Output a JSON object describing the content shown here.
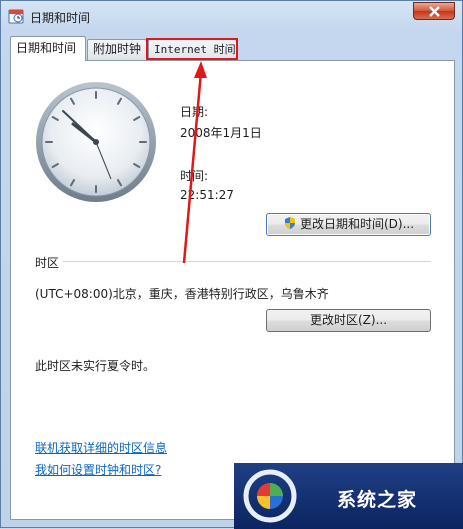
{
  "window": {
    "title": "日期和时间",
    "app_icon": "calendar-clock-icon",
    "close_icon": "close-icon"
  },
  "tabs": [
    {
      "label": "日期和时间",
      "selected": true
    },
    {
      "label": "附加时钟",
      "selected": false
    },
    {
      "label": "Internet 时间",
      "selected": false
    }
  ],
  "date": {
    "label": "日期:",
    "value": "2008年1月1日"
  },
  "time": {
    "label": "时间:",
    "value": "22:51:27"
  },
  "buttons": {
    "change_datetime": "更改日期和时间(D)...",
    "change_timezone": "更改时区(Z)..."
  },
  "timezone": {
    "section_label": "时区",
    "value": "(UTC+08:00)北京，重庆，香港特别行政区，乌鲁木齐",
    "dst_note": "此时区未实行夏令时。"
  },
  "links": {
    "tz_info": "联机获取详细的时区信息",
    "how_to": "我如何设置时钟和时区?"
  },
  "watermark": {
    "text": "系统之家"
  },
  "annotation": {
    "color": "#e01818"
  },
  "colors": {
    "link": "#0b66c3",
    "accent": "#e01818"
  }
}
